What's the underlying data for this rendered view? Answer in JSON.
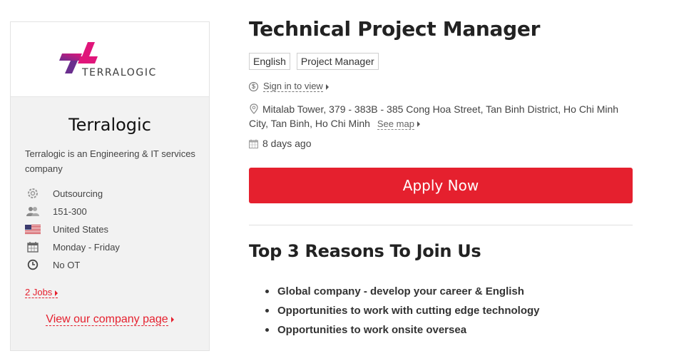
{
  "company": {
    "logo_text": "TERRALOGIC",
    "name": "Terralogic",
    "description": "Terralogic is an Engineering & IT services company",
    "info": [
      {
        "icon": "gear-icon",
        "text": "Outsourcing"
      },
      {
        "icon": "people-icon",
        "text": "151-300"
      },
      {
        "icon": "us-flag-icon",
        "text": "United States"
      },
      {
        "icon": "calendar-icon",
        "text": "Monday - Friday"
      },
      {
        "icon": "clock-icon",
        "text": "No OT"
      }
    ],
    "jobs_link": "2 Jobs",
    "view_company_link": "View our company page"
  },
  "job": {
    "title": "Technical Project Manager",
    "tags": [
      "English",
      "Project Manager"
    ],
    "salary_link": "Sign in to view",
    "address": "Mitalab Tower, 379 - 383B - 385 Cong Hoa Street, Tan Binh District, Ho Chi Minh City, Tan Binh, Ho Chi Minh",
    "see_map": "See map",
    "posted": "8 days ago",
    "apply_label": "Apply Now"
  },
  "reasons": {
    "title": "Top 3 Reasons To Join Us",
    "items": [
      "Global company - develop your career & English",
      "Opportunities to work with cutting edge technology",
      "Opportunities to work onsite oversea"
    ]
  },
  "colors": {
    "accent": "#e5202e",
    "logo_magenta": "#e0157a",
    "logo_purple": "#6a2e8e"
  }
}
